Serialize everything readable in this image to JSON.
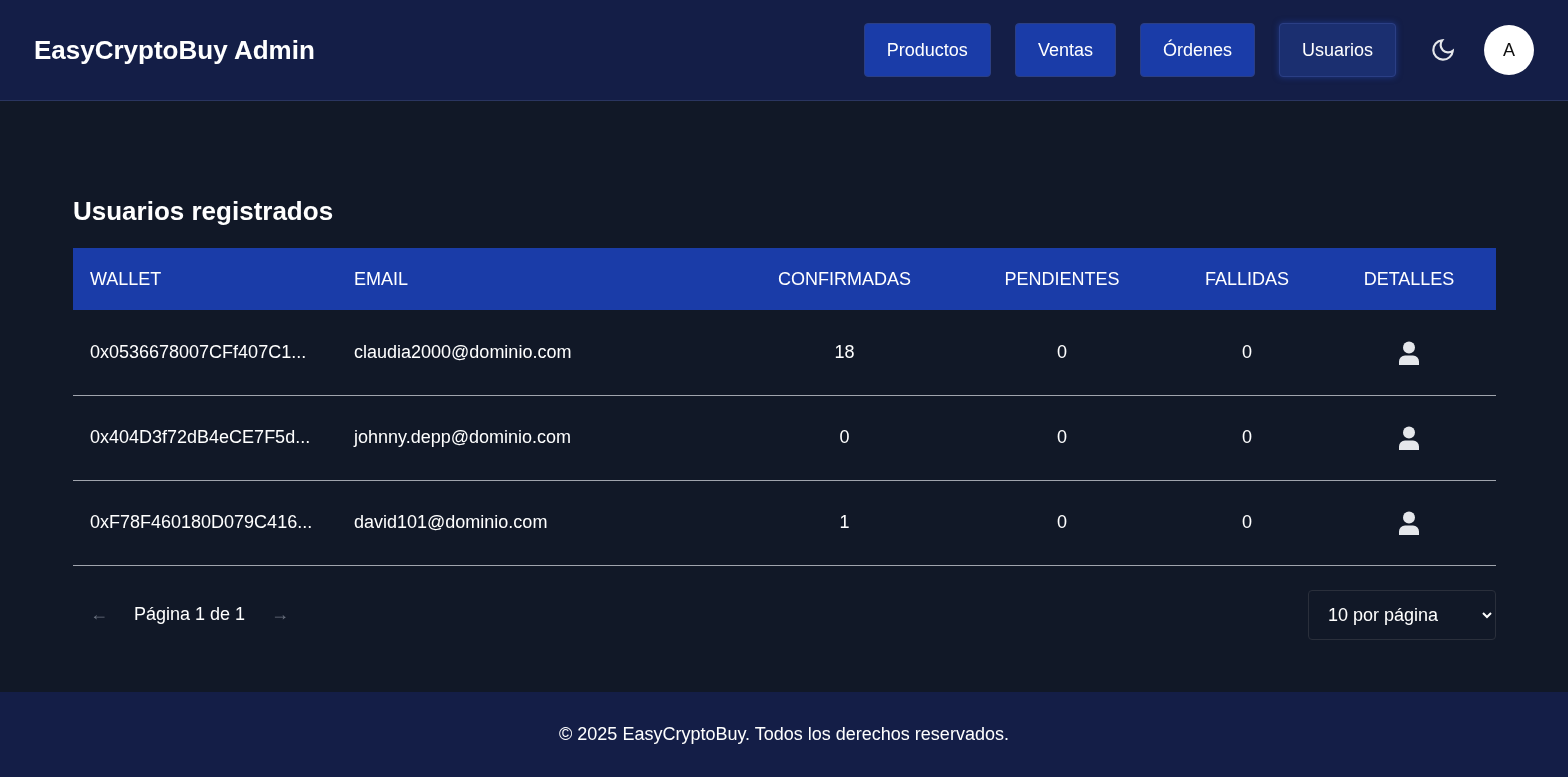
{
  "brand": "EasyCryptoBuy Admin",
  "nav": [
    {
      "label": "Productos",
      "selected": false
    },
    {
      "label": "Ventas",
      "selected": false
    },
    {
      "label": "Órdenes",
      "selected": false
    },
    {
      "label": "Usuarios",
      "selected": true
    }
  ],
  "avatar": "A",
  "title": "Usuarios registrados",
  "table": {
    "columns": [
      "WALLET",
      "EMAIL",
      "CONFIRMADAS",
      "PENDIENTES",
      "FALLIDAS",
      "DETALLES"
    ],
    "rows": [
      [
        "0x0536678007CFf407C1...",
        "claudia2000@dominio.com",
        "18",
        "0",
        "0"
      ],
      [
        "0x404D3f72dB4eCE7F5d...",
        "johnny.depp@dominio.com",
        "0",
        "0",
        "0"
      ],
      [
        "0xF78F460180D079C416...",
        "david101@dominio.com",
        "1",
        "0",
        "0"
      ]
    ]
  },
  "pagination": {
    "prev": {
      "label": "←",
      "disabled": true
    },
    "text": "Página 1 de 1",
    "next": {
      "label": "→",
      "disabled": true
    },
    "page_size": "10 por página"
  },
  "footer": "© 2025 EasyCryptoBuy. Todos los derechos reservados."
}
